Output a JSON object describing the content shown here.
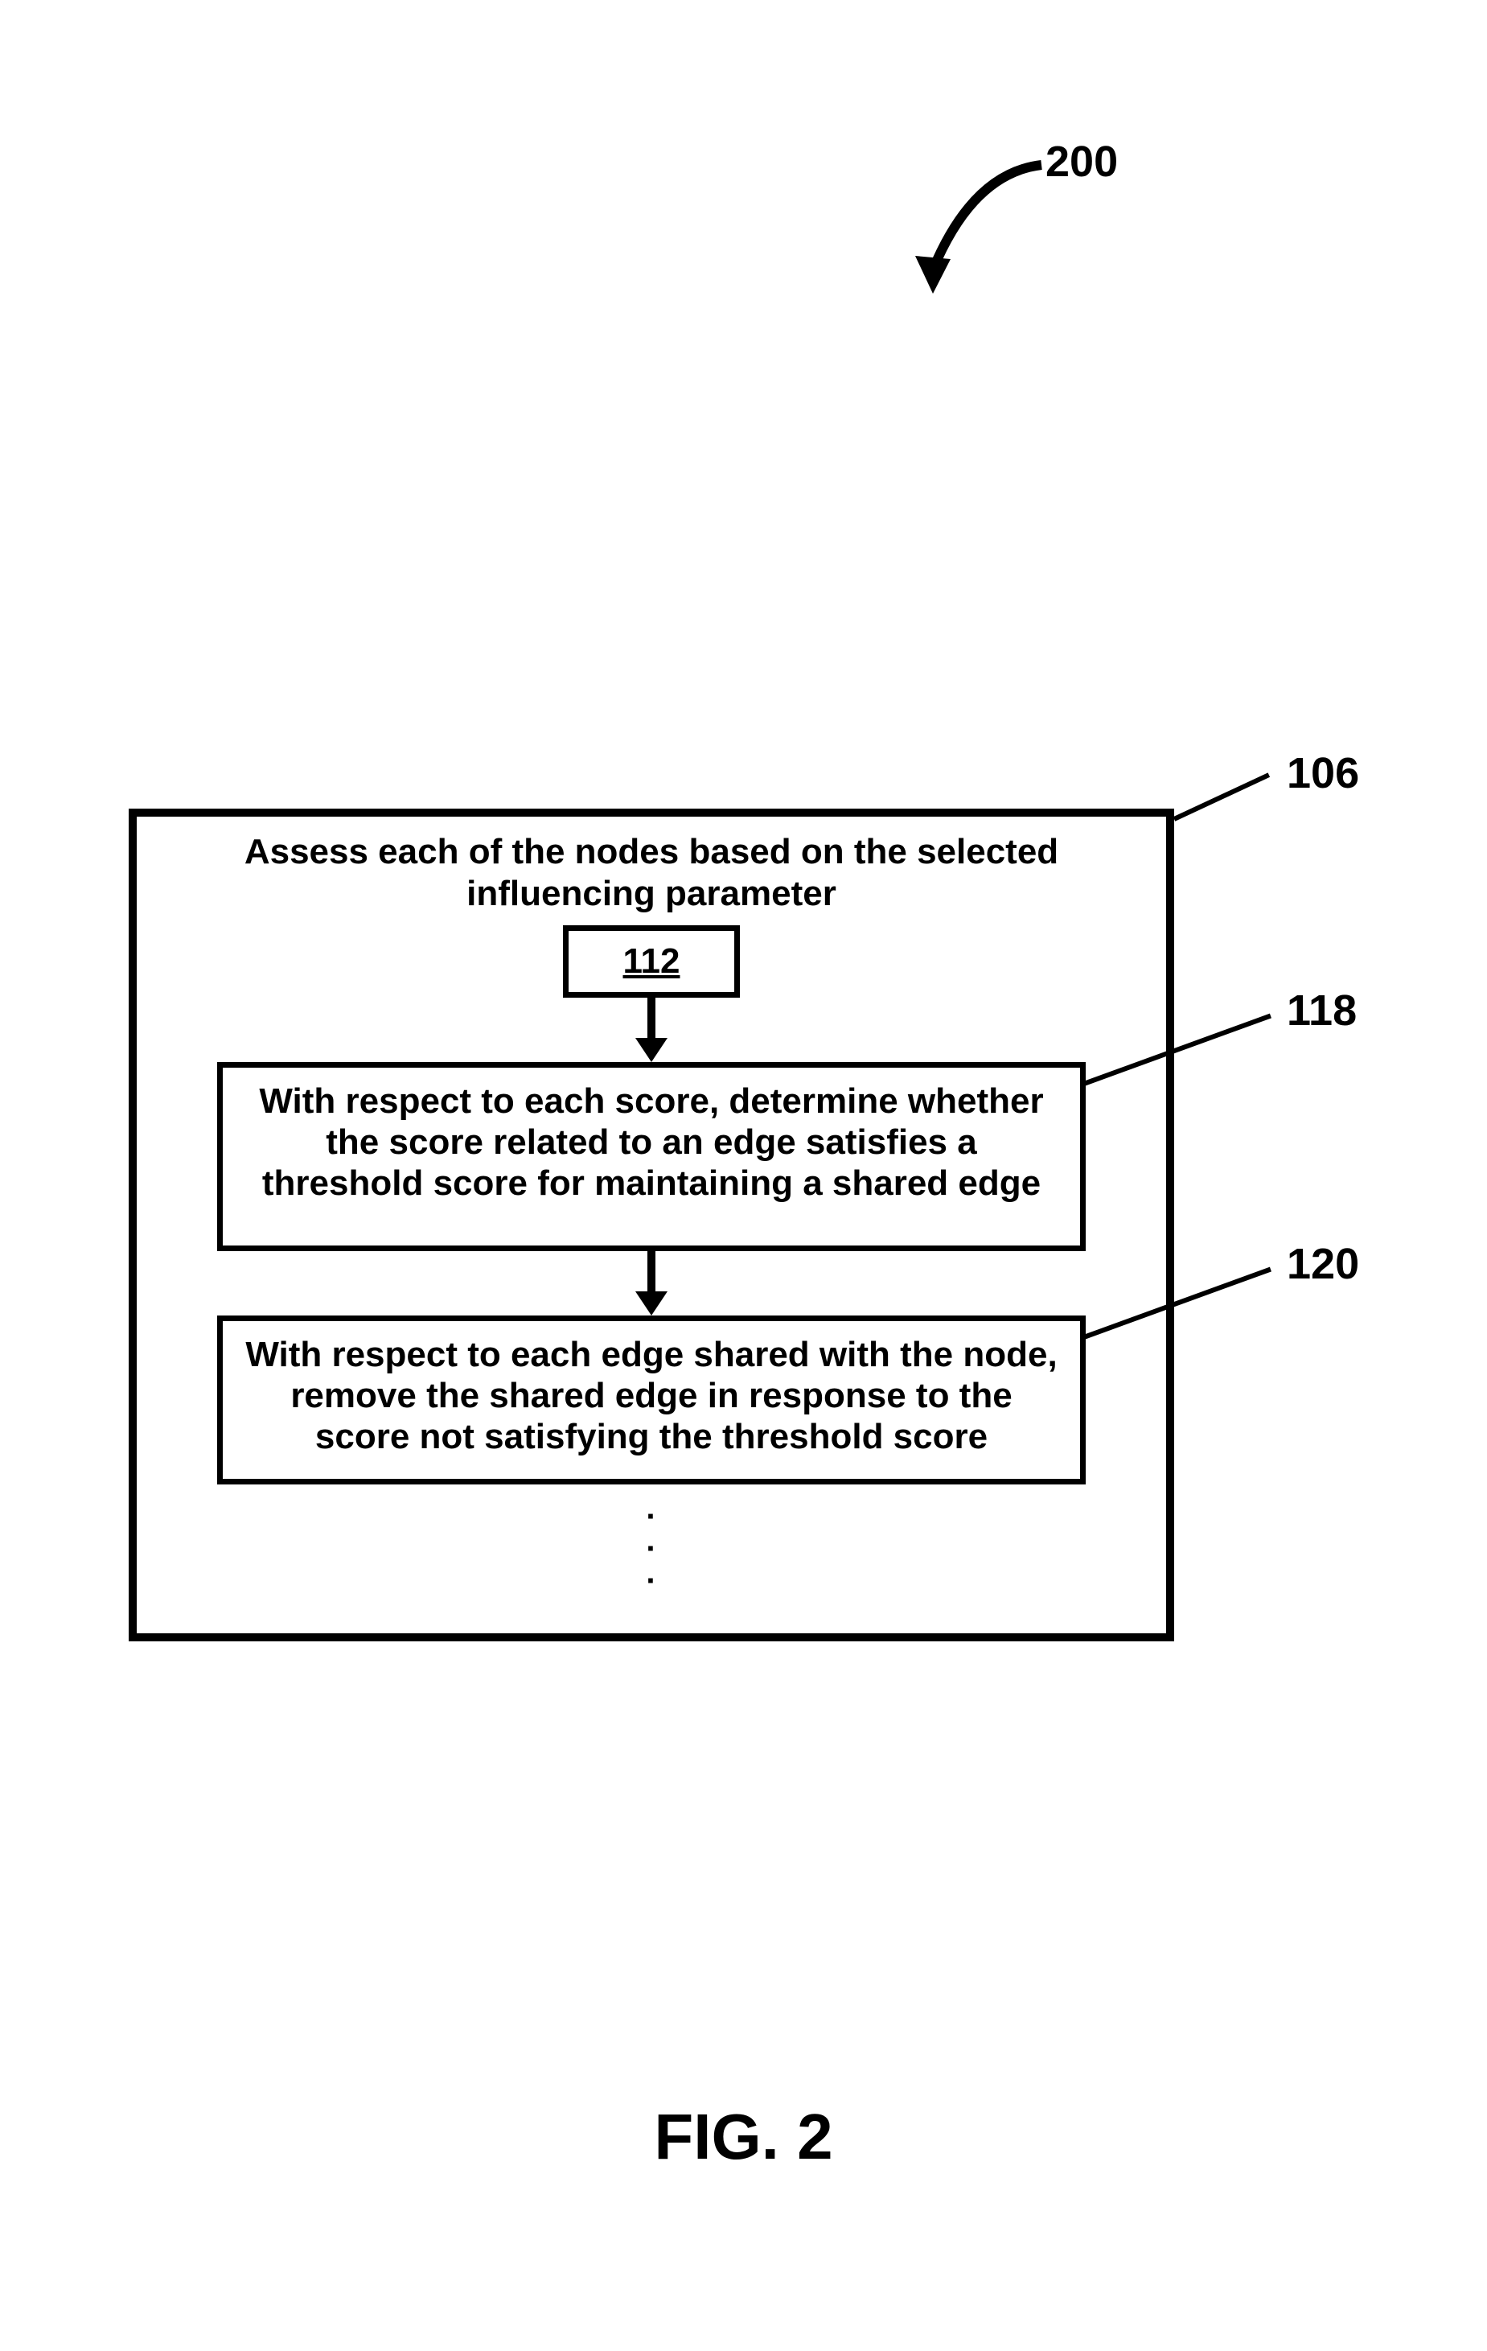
{
  "figure": {
    "ref_label_top": "200",
    "container_ref": "106",
    "step1_ref": "118",
    "step2_ref": "120",
    "caption": "FIG. 2"
  },
  "container": {
    "title": "Assess each of the nodes based on the selected influencing parameter",
    "inner_ref_box": "112"
  },
  "steps": {
    "s118": "With respect to each score, determine whether the score related to an edge satisfies a threshold score for maintaining a shared edge",
    "s120": "With respect to each edge shared with the node, remove the shared edge in response to the score not satisfying the threshold score"
  }
}
